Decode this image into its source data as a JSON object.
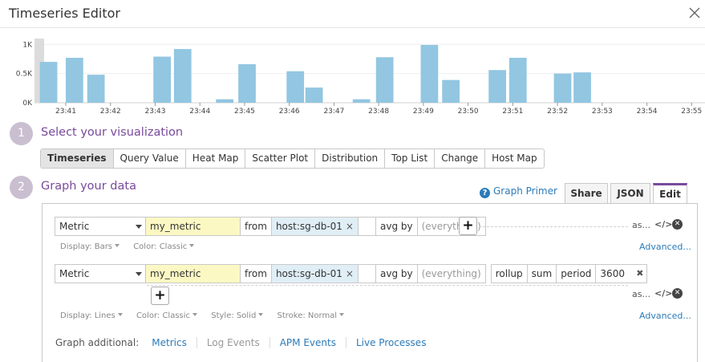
{
  "window": {
    "title": "Timeseries Editor",
    "close_icon": "close-icon"
  },
  "chart_data": {
    "type": "bar",
    "ylabel": "",
    "xlabel": "",
    "y_ticks": [
      "0K",
      "0.5K",
      "1K"
    ],
    "ylim": [
      0,
      1100
    ],
    "x_ticks": [
      "23:41",
      "23:42",
      "23:43",
      "23:44",
      "23:45",
      "23:46",
      "23:47",
      "23:48",
      "23:49",
      "23:50",
      "23:51",
      "23:52",
      "23:53",
      "23:54",
      "23:55"
    ],
    "x_tick_minutes": [
      41,
      42,
      43,
      44,
      45,
      46,
      47,
      48,
      49,
      50,
      51,
      52,
      53,
      54,
      55
    ],
    "xlim_minutes": [
      40.3,
      55.3
    ],
    "bar_width_minutes": 0.39,
    "color": "#92c6e1",
    "bars": [
      {
        "x": 40.42,
        "value": 700
      },
      {
        "x": 41.0,
        "value": 770
      },
      {
        "x": 41.48,
        "value": 480
      },
      {
        "x": 42.96,
        "value": 790
      },
      {
        "x": 43.42,
        "value": 920
      },
      {
        "x": 44.36,
        "value": 60
      },
      {
        "x": 44.86,
        "value": 660
      },
      {
        "x": 45.94,
        "value": 540
      },
      {
        "x": 46.36,
        "value": 260
      },
      {
        "x": 47.42,
        "value": 60
      },
      {
        "x": 47.94,
        "value": 780
      },
      {
        "x": 48.94,
        "value": 990
      },
      {
        "x": 49.42,
        "value": 390
      },
      {
        "x": 50.46,
        "value": 560
      },
      {
        "x": 50.92,
        "value": 770
      },
      {
        "x": 51.92,
        "value": 500
      },
      {
        "x": 52.36,
        "value": 520
      }
    ],
    "grid": true
  },
  "steps": {
    "s1": {
      "num": "1",
      "title": "Select your visualization"
    },
    "s2": {
      "num": "2",
      "title": "Graph your data"
    }
  },
  "viz_tabs": [
    "Timeseries",
    "Query Value",
    "Heat Map",
    "Scatter Plot",
    "Distribution",
    "Top List",
    "Change",
    "Host Map"
  ],
  "viz_active": "Timeseries",
  "primer": {
    "icon": "help-icon",
    "glyph": "?",
    "label": "Graph Primer"
  },
  "edit_tabs": {
    "share": "Share",
    "json": "JSON",
    "edit": "Edit"
  },
  "queries": [
    {
      "type": "Metric",
      "metric": "my_metric",
      "from_label": "from",
      "scope": "host:sg-db-01",
      "remove_glyph": "×",
      "agg_label": "avg by",
      "agg_placeholder": "(everything)",
      "alias": "as...",
      "code_glyph": "</>",
      "delete_glyph": "✕",
      "options": [
        {
          "label": "Display:",
          "value": "Bars"
        },
        {
          "label": "Color:",
          "value": "Classic"
        }
      ],
      "advanced": "Advanced..."
    },
    {
      "type": "Metric",
      "metric": "my_metric",
      "from_label": "from",
      "scope": "host:sg-db-01",
      "remove_glyph": "×",
      "agg_label": "avg by",
      "agg_placeholder": "(everything)",
      "fn_rollup": "rollup",
      "fn_method": "sum",
      "fn_period_label": "period",
      "fn_period_value": "3600",
      "fn_remove_glyph": "✖",
      "alias": "as...",
      "code_glyph": "</>",
      "delete_glyph": "✕",
      "options": [
        {
          "label": "Display:",
          "value": "Lines"
        },
        {
          "label": "Color:",
          "value": "Classic"
        },
        {
          "label": "Style:",
          "value": "Solid"
        },
        {
          "label": "Stroke:",
          "value": "Normal"
        }
      ],
      "advanced": "Advanced..."
    }
  ],
  "plus_glyph": "+",
  "graph_additional": {
    "label": "Graph additional:",
    "links": [
      "Metrics",
      "Log Events",
      "APM Events",
      "Live Processes"
    ]
  }
}
